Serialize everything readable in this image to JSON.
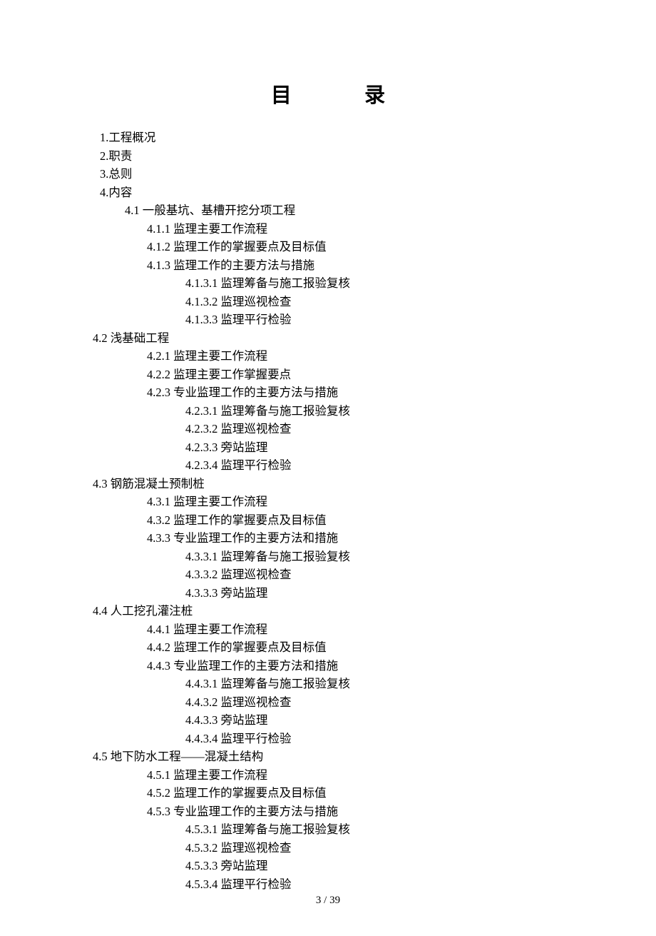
{
  "title_char1": "目",
  "title_char2": "录",
  "toc": {
    "i1": "1.工程概况",
    "i2": "2.职责",
    "i3": "3.总则",
    "i4": "4.内容",
    "i41": "4.1  一般基坑、基槽开挖分项工程",
    "i411": "4.1.1  监理主要工作流程",
    "i412": "4.1.2  监理工作的掌握要点及目标值",
    "i413": "4.1.3  监理工作的主要方法与措施",
    "i4131": "4.1.3.1  监理筹备与施工报验复核",
    "i4132": "4.1.3.2  监理巡视检查",
    "i4133": "4.1.3.3  监理平行检验",
    "i42": "4.2  浅基础工程",
    "i421": "4.2.1  监理主要工作流程",
    "i422": "4.2.2  监理主要工作掌握要点",
    "i423": "4.2.3  专业监理工作的主要方法与措施",
    "i4231": "4.2.3.1  监理筹备与施工报验复核",
    "i4232": "4.2.3.2  监理巡视检查",
    "i4233": "4.2.3.3  旁站监理",
    "i4234": "4.2.3.4  监理平行检验",
    "i43": "4.3  钢筋混凝土预制桩",
    "i431": "4.3.1  监理主要工作流程",
    "i432": "4.3.2  监理工作的掌握要点及目标值",
    "i433": "4.3.3  专业监理工作的主要方法和措施",
    "i4331": "4.3.3.1  监理筹备与施工报验复核",
    "i4332": "4.3.3.2  监理巡视检查",
    "i4333": "4.3.3.3  旁站监理",
    "i44": "4.4  人工挖孔灌注桩",
    "i441": "4.4.1  监理主要工作流程",
    "i442": "4.4.2  监理工作的掌握要点及目标值",
    "i443": "4.4.3  专业监理工作的主要方法和措施",
    "i4431": "4.4.3.1  监理筹备与施工报验复核",
    "i4432": "4.4.3.2  监理巡视检查",
    "i4433": "4.4.3.3  旁站监理",
    "i4434": "4.4.3.4  监理平行检验",
    "i45": "4.5  地下防水工程——混凝土结构",
    "i451": "4.5.1  监理主要工作流程",
    "i452": "4.5.2  监理工作的掌握要点及目标值",
    "i453": "4.5.3  专业监理工作的主要方法与措施",
    "i4531": "4.5.3.1  监理筹备与施工报验复核",
    "i4532": "4.5.3.2  监理巡视检查",
    "i4533": "4.5.3.3  旁站监理",
    "i4534": "4.5.3.4  监理平行检验"
  },
  "page_number": "3  / 39"
}
